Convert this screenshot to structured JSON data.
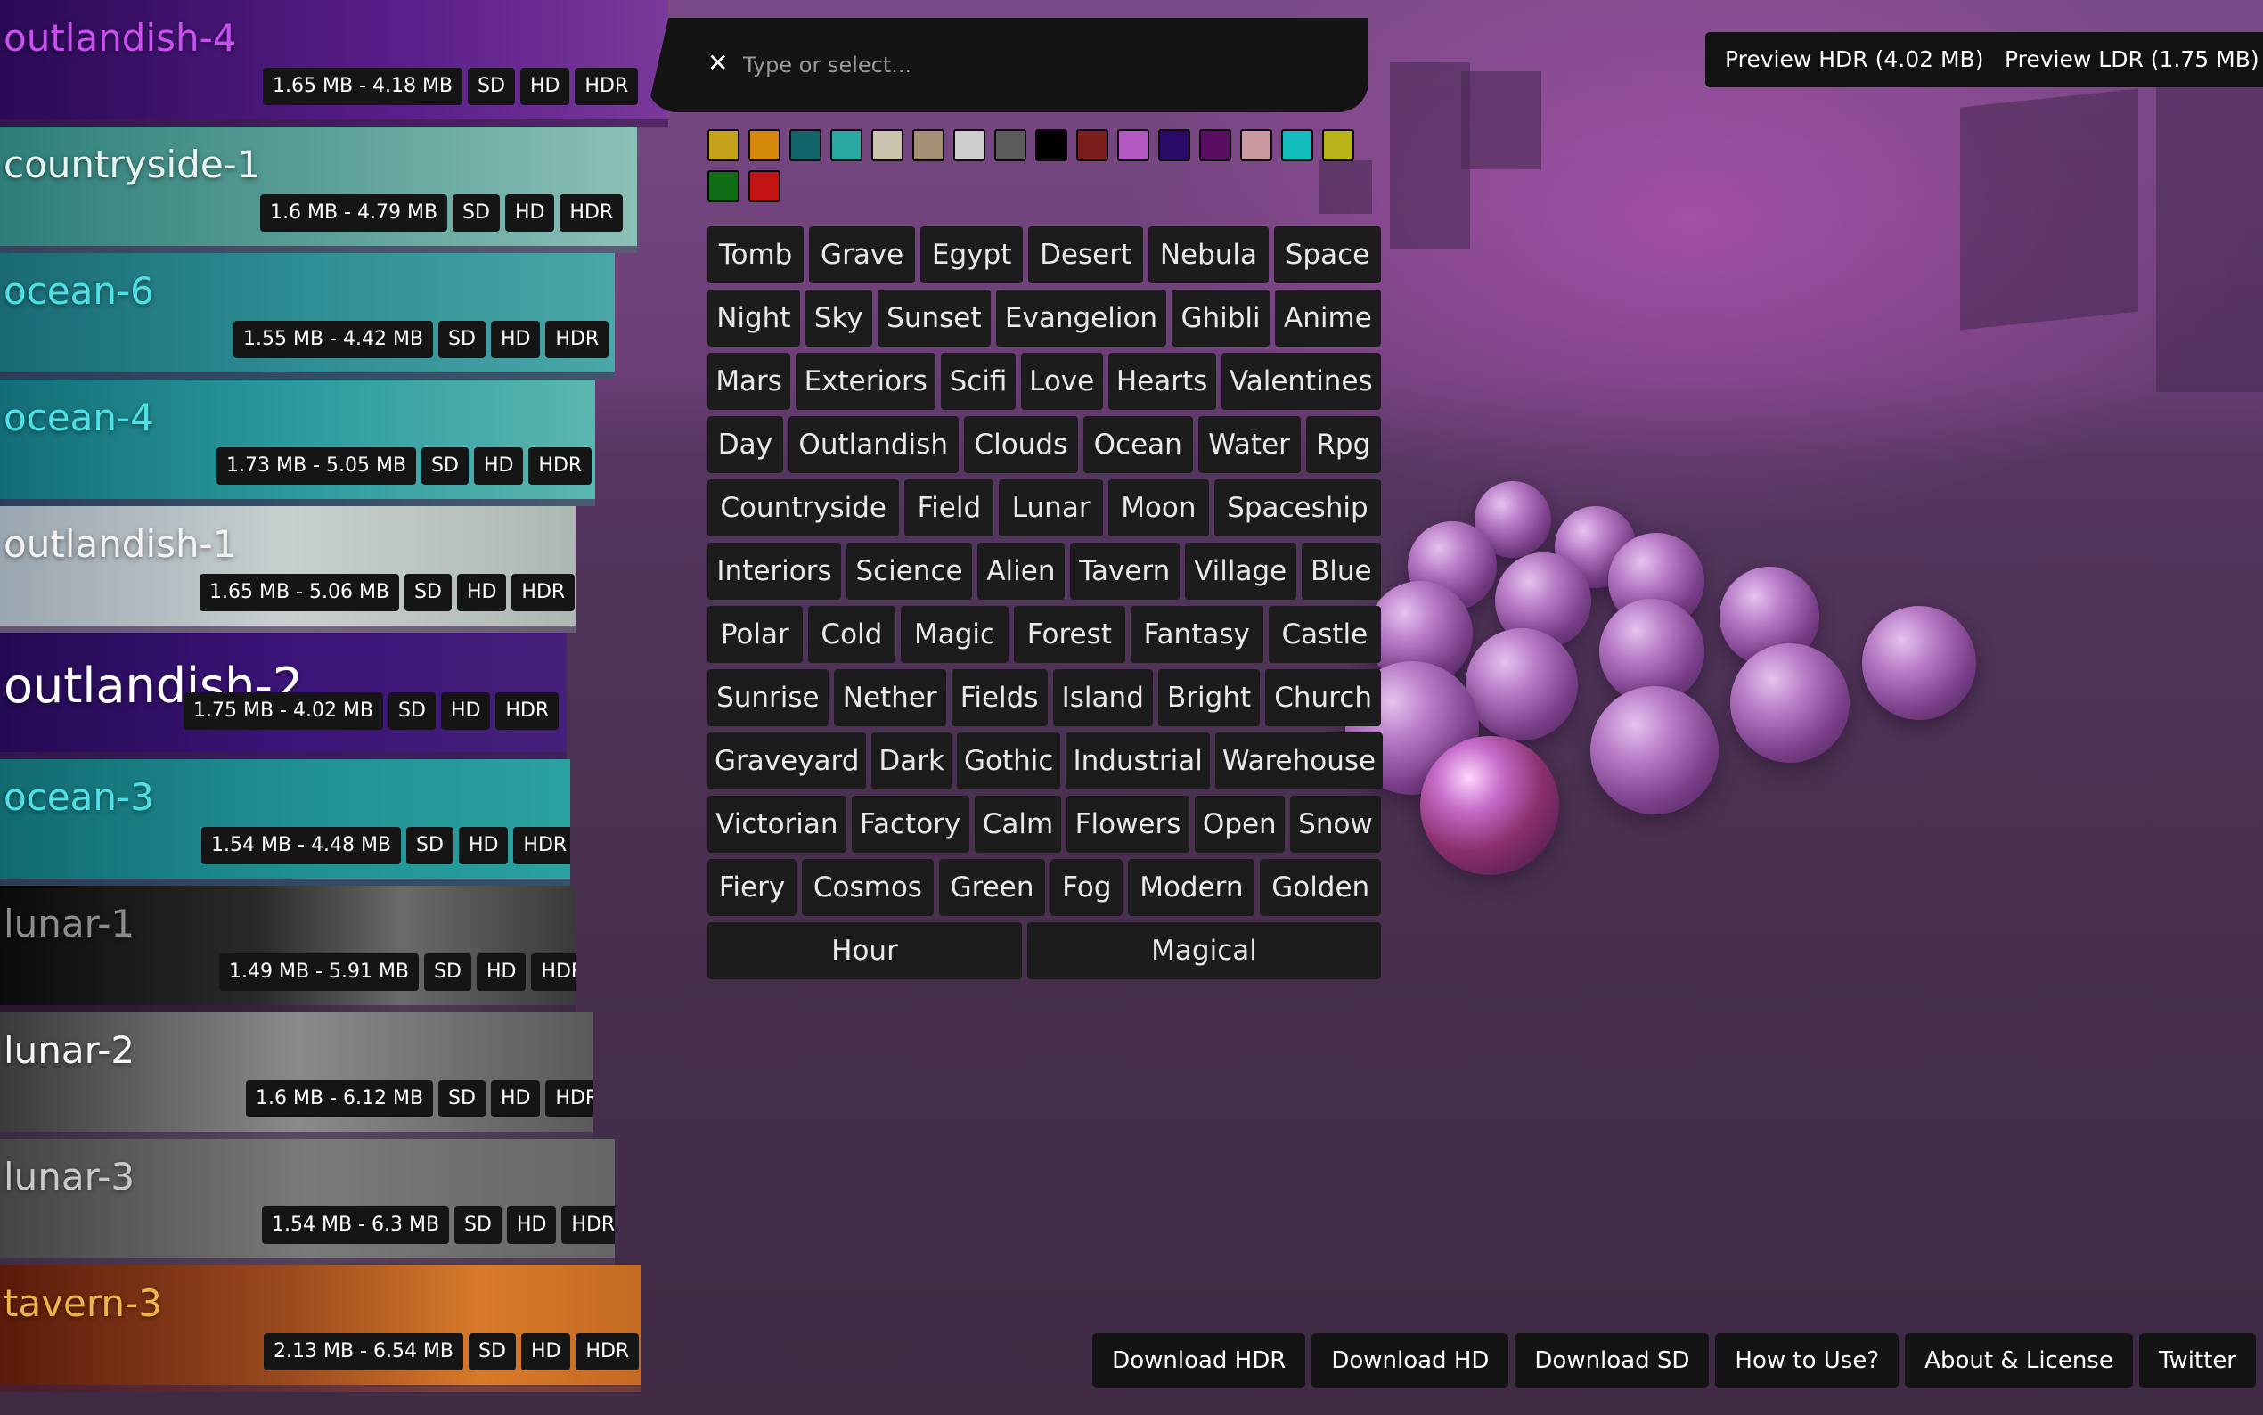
{
  "search": {
    "placeholder": "Type or select...",
    "clear_icon": "✕"
  },
  "colors": [
    "#c4a21a",
    "#d4880c",
    "#13656a",
    "#2aa9a4",
    "#c9c2ad",
    "#a48f74",
    "#cfcfcf",
    "#5c5c5c",
    "#000000",
    "#7a1e1e",
    "#b259c2",
    "#2a0a66",
    "#5a0e63",
    "#c99aa2",
    "#13bcbc",
    "#b8b318",
    "#0f6b14",
    "#c41515"
  ],
  "tag_rows": [
    [
      "Tomb",
      "Grave",
      "Egypt",
      "Desert",
      "Nebula",
      "Space"
    ],
    [
      "Night",
      "Sky",
      "Sunset",
      "Evangelion",
      "Ghibli",
      "Anime"
    ],
    [
      "Mars",
      "Exteriors",
      "Scifi",
      "Love",
      "Hearts",
      "Valentines"
    ],
    [
      "Day",
      "Outlandish",
      "Clouds",
      "Ocean",
      "Water",
      "Rpg"
    ],
    [
      "Countryside",
      "Field",
      "Lunar",
      "Moon",
      "Spaceship"
    ],
    [
      "Interiors",
      "Science",
      "Alien",
      "Tavern",
      "Village",
      "Blue"
    ],
    [
      "Polar",
      "Cold",
      "Magic",
      "Forest",
      "Fantasy",
      "Castle"
    ],
    [
      "Sunrise",
      "Nether",
      "Fields",
      "Island",
      "Bright",
      "Church"
    ],
    [
      "Graveyard",
      "Dark",
      "Gothic",
      "Industrial",
      "Warehouse"
    ],
    [
      "Victorian",
      "Factory",
      "Calm",
      "Flowers",
      "Open",
      "Snow"
    ],
    [
      "Fiery",
      "Cosmos",
      "Green",
      "Fog",
      "Modern",
      "Golden"
    ],
    [
      "Hour",
      "Magical"
    ]
  ],
  "environments": [
    {
      "name": "outlandish-4",
      "size": "1.65 MB - 4.18 MB",
      "color": "#c94ff0"
    },
    {
      "name": "countryside-1",
      "size": "1.6 MB - 4.79 MB",
      "color": "#e8f3ef"
    },
    {
      "name": "ocean-6",
      "size": "1.55 MB - 4.42 MB",
      "color": "#4fe0e6"
    },
    {
      "name": "ocean-4",
      "size": "1.73 MB - 5.05 MB",
      "color": "#4fe0e6"
    },
    {
      "name": "outlandish-1",
      "size": "1.65 MB - 5.06 MB",
      "color": "#f2f2f2"
    },
    {
      "name": "outlandish-2",
      "size": "1.75 MB - 4.02 MB",
      "color": "#ffffff"
    },
    {
      "name": "ocean-3",
      "size": "1.54 MB - 4.48 MB",
      "color": "#4fe0e6"
    },
    {
      "name": "lunar-1",
      "size": "1.49 MB - 5.91 MB",
      "color": "#8c8c8c"
    },
    {
      "name": "lunar-2",
      "size": "1.6 MB - 6.12 MB",
      "color": "#f5f5f5"
    },
    {
      "name": "lunar-3",
      "size": "1.54 MB - 6.3 MB",
      "color": "#c8c8c8"
    },
    {
      "name": "tavern-3",
      "size": "2.13 MB - 6.54 MB",
      "color": "#f0b54a"
    }
  ],
  "quality_labels": {
    "sd": "SD",
    "hd": "HD",
    "hdr": "HDR"
  },
  "preview": {
    "hdr": "Preview HDR (4.02 MB)",
    "ldr": "Preview LDR (1.75 MB)"
  },
  "footer": [
    "Download HDR",
    "Download HD",
    "Download SD",
    "How to Use?",
    "About & License",
    "Twitter"
  ]
}
